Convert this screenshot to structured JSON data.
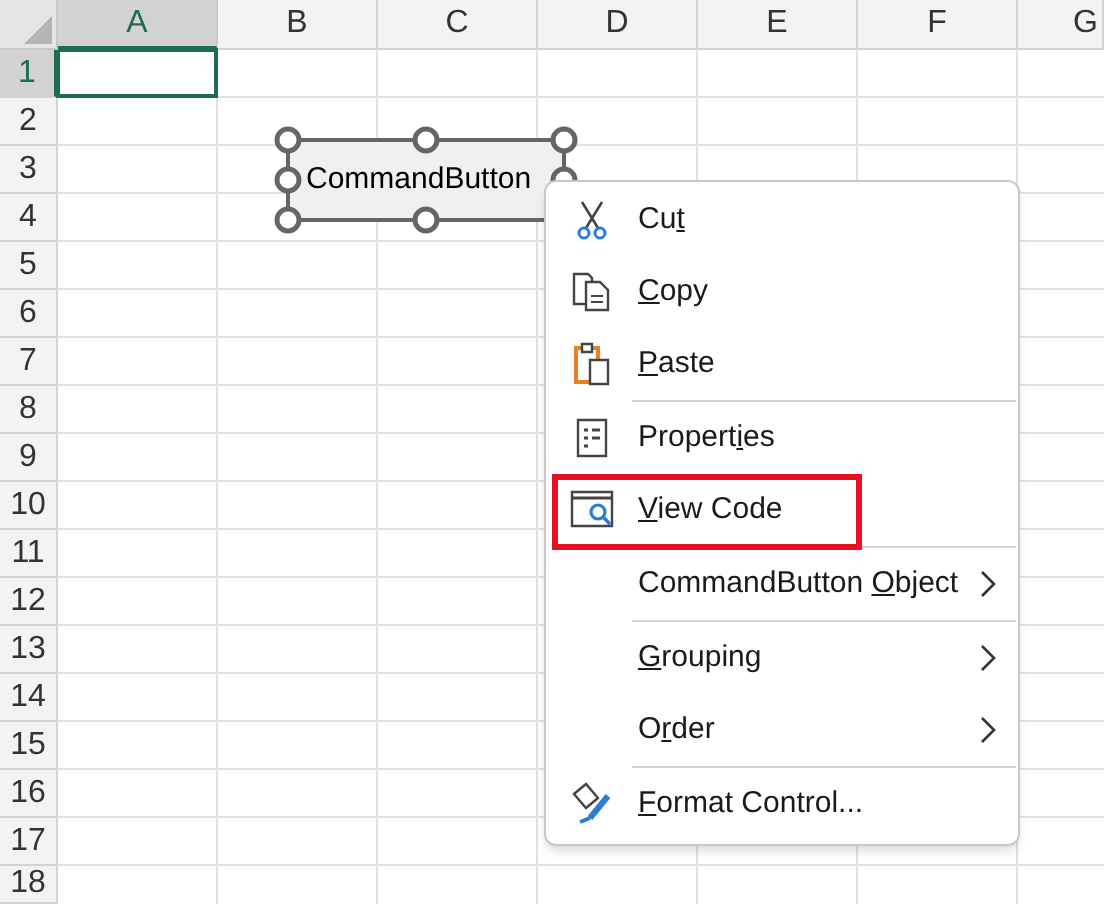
{
  "columns": [
    {
      "label": "A",
      "selected": true
    },
    {
      "label": "B",
      "selected": false
    },
    {
      "label": "C",
      "selected": false
    },
    {
      "label": "D",
      "selected": false
    },
    {
      "label": "E",
      "selected": false
    },
    {
      "label": "F",
      "selected": false
    },
    {
      "label": "G",
      "selected": false
    }
  ],
  "rows": [
    {
      "label": "1",
      "selected": true
    },
    {
      "label": "2",
      "selected": false
    },
    {
      "label": "3",
      "selected": false
    },
    {
      "label": "4",
      "selected": false
    },
    {
      "label": "5",
      "selected": false
    },
    {
      "label": "6",
      "selected": false
    },
    {
      "label": "7",
      "selected": false
    },
    {
      "label": "8",
      "selected": false
    },
    {
      "label": "9",
      "selected": false
    },
    {
      "label": "10",
      "selected": false
    },
    {
      "label": "11",
      "selected": false
    },
    {
      "label": "12",
      "selected": false
    },
    {
      "label": "13",
      "selected": false
    },
    {
      "label": "14",
      "selected": false
    },
    {
      "label": "15",
      "selected": false
    },
    {
      "label": "16",
      "selected": false
    },
    {
      "label": "17",
      "selected": false
    },
    {
      "label": "18",
      "selected": false
    }
  ],
  "command_button": {
    "label": "CommandButton",
    "selected": true
  },
  "context_menu": {
    "items": [
      {
        "before": "Cu",
        "key": "t",
        "separator_before": false,
        "submenu": false,
        "highlighted": false
      },
      {
        "key": "C",
        "after": "opy",
        "separator_before": false,
        "submenu": false,
        "highlighted": false
      },
      {
        "key": "P",
        "after": "aste",
        "separator_before": false,
        "submenu": false,
        "highlighted": false
      },
      {
        "before": "Propert",
        "key": "i",
        "after": "es",
        "separator_before": true,
        "submenu": false,
        "highlighted": false
      },
      {
        "key": "V",
        "after": "iew Code",
        "separator_before": false,
        "submenu": false,
        "highlighted": true
      },
      {
        "before": "CommandButton ",
        "key": "O",
        "after": "bject",
        "separator_before": true,
        "submenu": true,
        "highlighted": false
      },
      {
        "key": "G",
        "after": "rouping",
        "separator_before": true,
        "submenu": true,
        "highlighted": false
      },
      {
        "before": "O",
        "key": "r",
        "after": "der",
        "separator_before": false,
        "submenu": true,
        "highlighted": false
      },
      {
        "key": "F",
        "after": "ormat Control...",
        "separator_before": true,
        "submenu": false,
        "highlighted": false
      }
    ]
  }
}
